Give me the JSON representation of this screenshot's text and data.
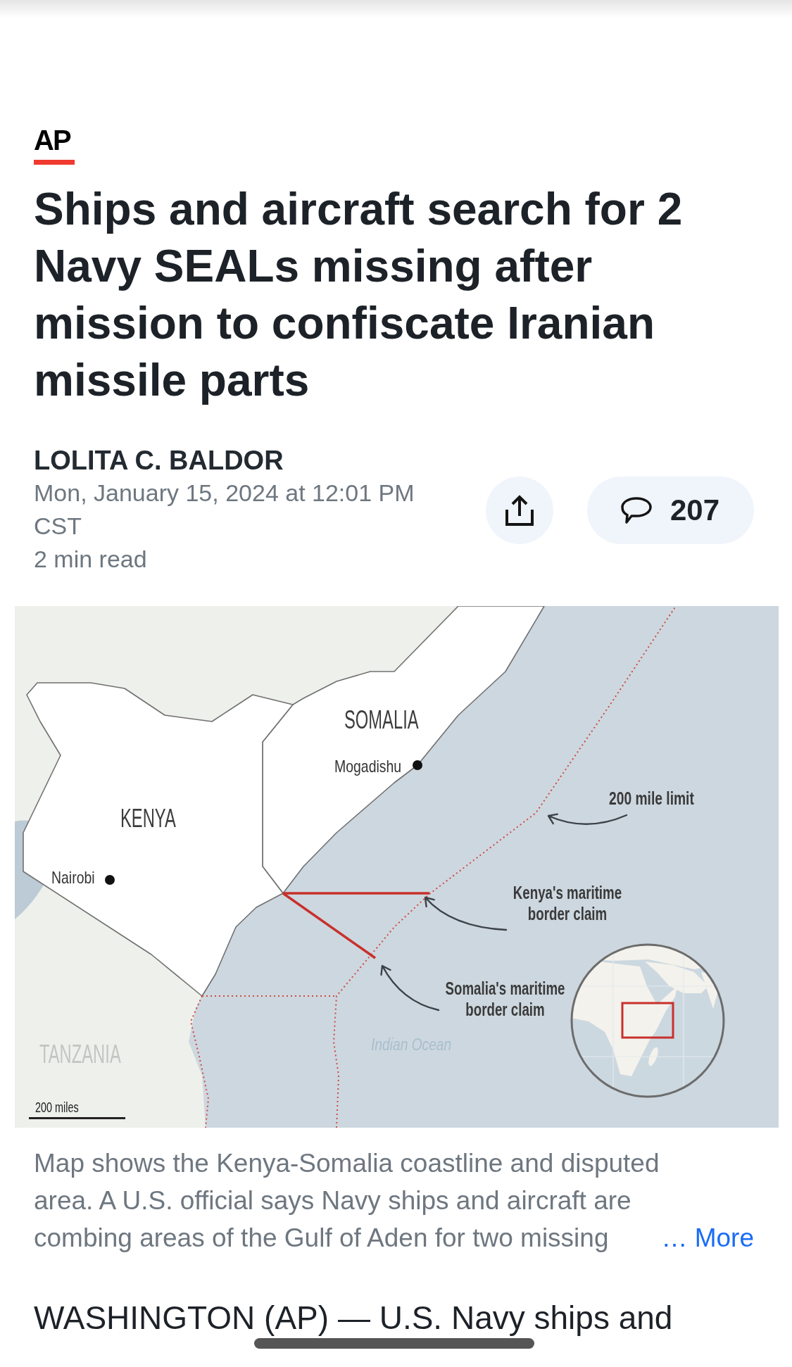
{
  "publisher": {
    "logo": "AP"
  },
  "headline": "Ships and aircraft search for 2 Navy SEALs missing after mission to confiscate Iranian missile parts",
  "byline": {
    "author": "LOLITA C. BALDOR",
    "timestamp": "Mon, January 15, 2024 at 12:01 PM CST",
    "read_time": "2 min read"
  },
  "actions": {
    "comment_count": "207"
  },
  "map": {
    "countries": [
      {
        "name": "SOMALIA",
        "highlighted": true
      },
      {
        "name": "KENYA",
        "highlighted": true
      },
      {
        "name": "TANZANIA",
        "highlighted": false
      }
    ],
    "cities": [
      "Mogadishu",
      "Nairobi"
    ],
    "callouts": [
      "200 mile limit",
      "Kenya's maritime border claim",
      "Somalia's maritime border claim"
    ],
    "water_label": "Indian Ocean",
    "scale_label": "200 miles"
  },
  "caption": {
    "text": "Map shows the Kenya-Somalia coastline and disputed area. A U.S. official says Navy ships and aircraft are combing areas of the Gulf of Aden for two missing",
    "more_link": "… More"
  },
  "body": [
    "WASHINGTON (AP) — U.S. Navy ships and"
  ]
}
